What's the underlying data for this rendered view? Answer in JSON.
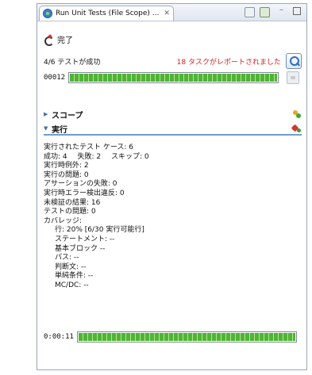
{
  "tab": {
    "title": "Run Unit Tests (File Scope) ...",
    "close": "✕"
  },
  "status": {
    "done_label": "完了",
    "success_text": "4/6 テストが成功",
    "warning_text": "18 タスクがレポートされました",
    "warning_color": "#d2231f"
  },
  "progress": {
    "time": "00012",
    "fraction": 1.0
  },
  "sections": {
    "scope_label": "スコープ",
    "run_label": "実行"
  },
  "stats": {
    "executed": "実行されたテスト ケース: 6",
    "result_success": "成功:  4",
    "result_fail": "失敗: 2",
    "result_skip": "スキップ: 0",
    "runtime_exceptions": "実行時例外: 2",
    "run_issues": "実行の問題: 0",
    "assertion_failures": "アサーションの失敗: 0",
    "runtime_violations": "実行時エラー検出違反: 0",
    "unverified": "未検証の結果: 16",
    "test_issues": "テストの問題: 0",
    "coverage_label": "カバレッジ:",
    "coverage": {
      "line": "行: 20% [6/30 実行可能行]",
      "statement": "ステートメント: --",
      "basic_block": "基本ブロック --",
      "path": "パス: --",
      "decision": "判断文: --",
      "condition": "単純条件: --",
      "mcdc": "MC/DC: --"
    }
  },
  "progress2": {
    "time": "0:00:11",
    "fraction": 1.0
  },
  "colors": {
    "progress_green": "#4fb436",
    "accent_blue": "#6e9cd1"
  }
}
